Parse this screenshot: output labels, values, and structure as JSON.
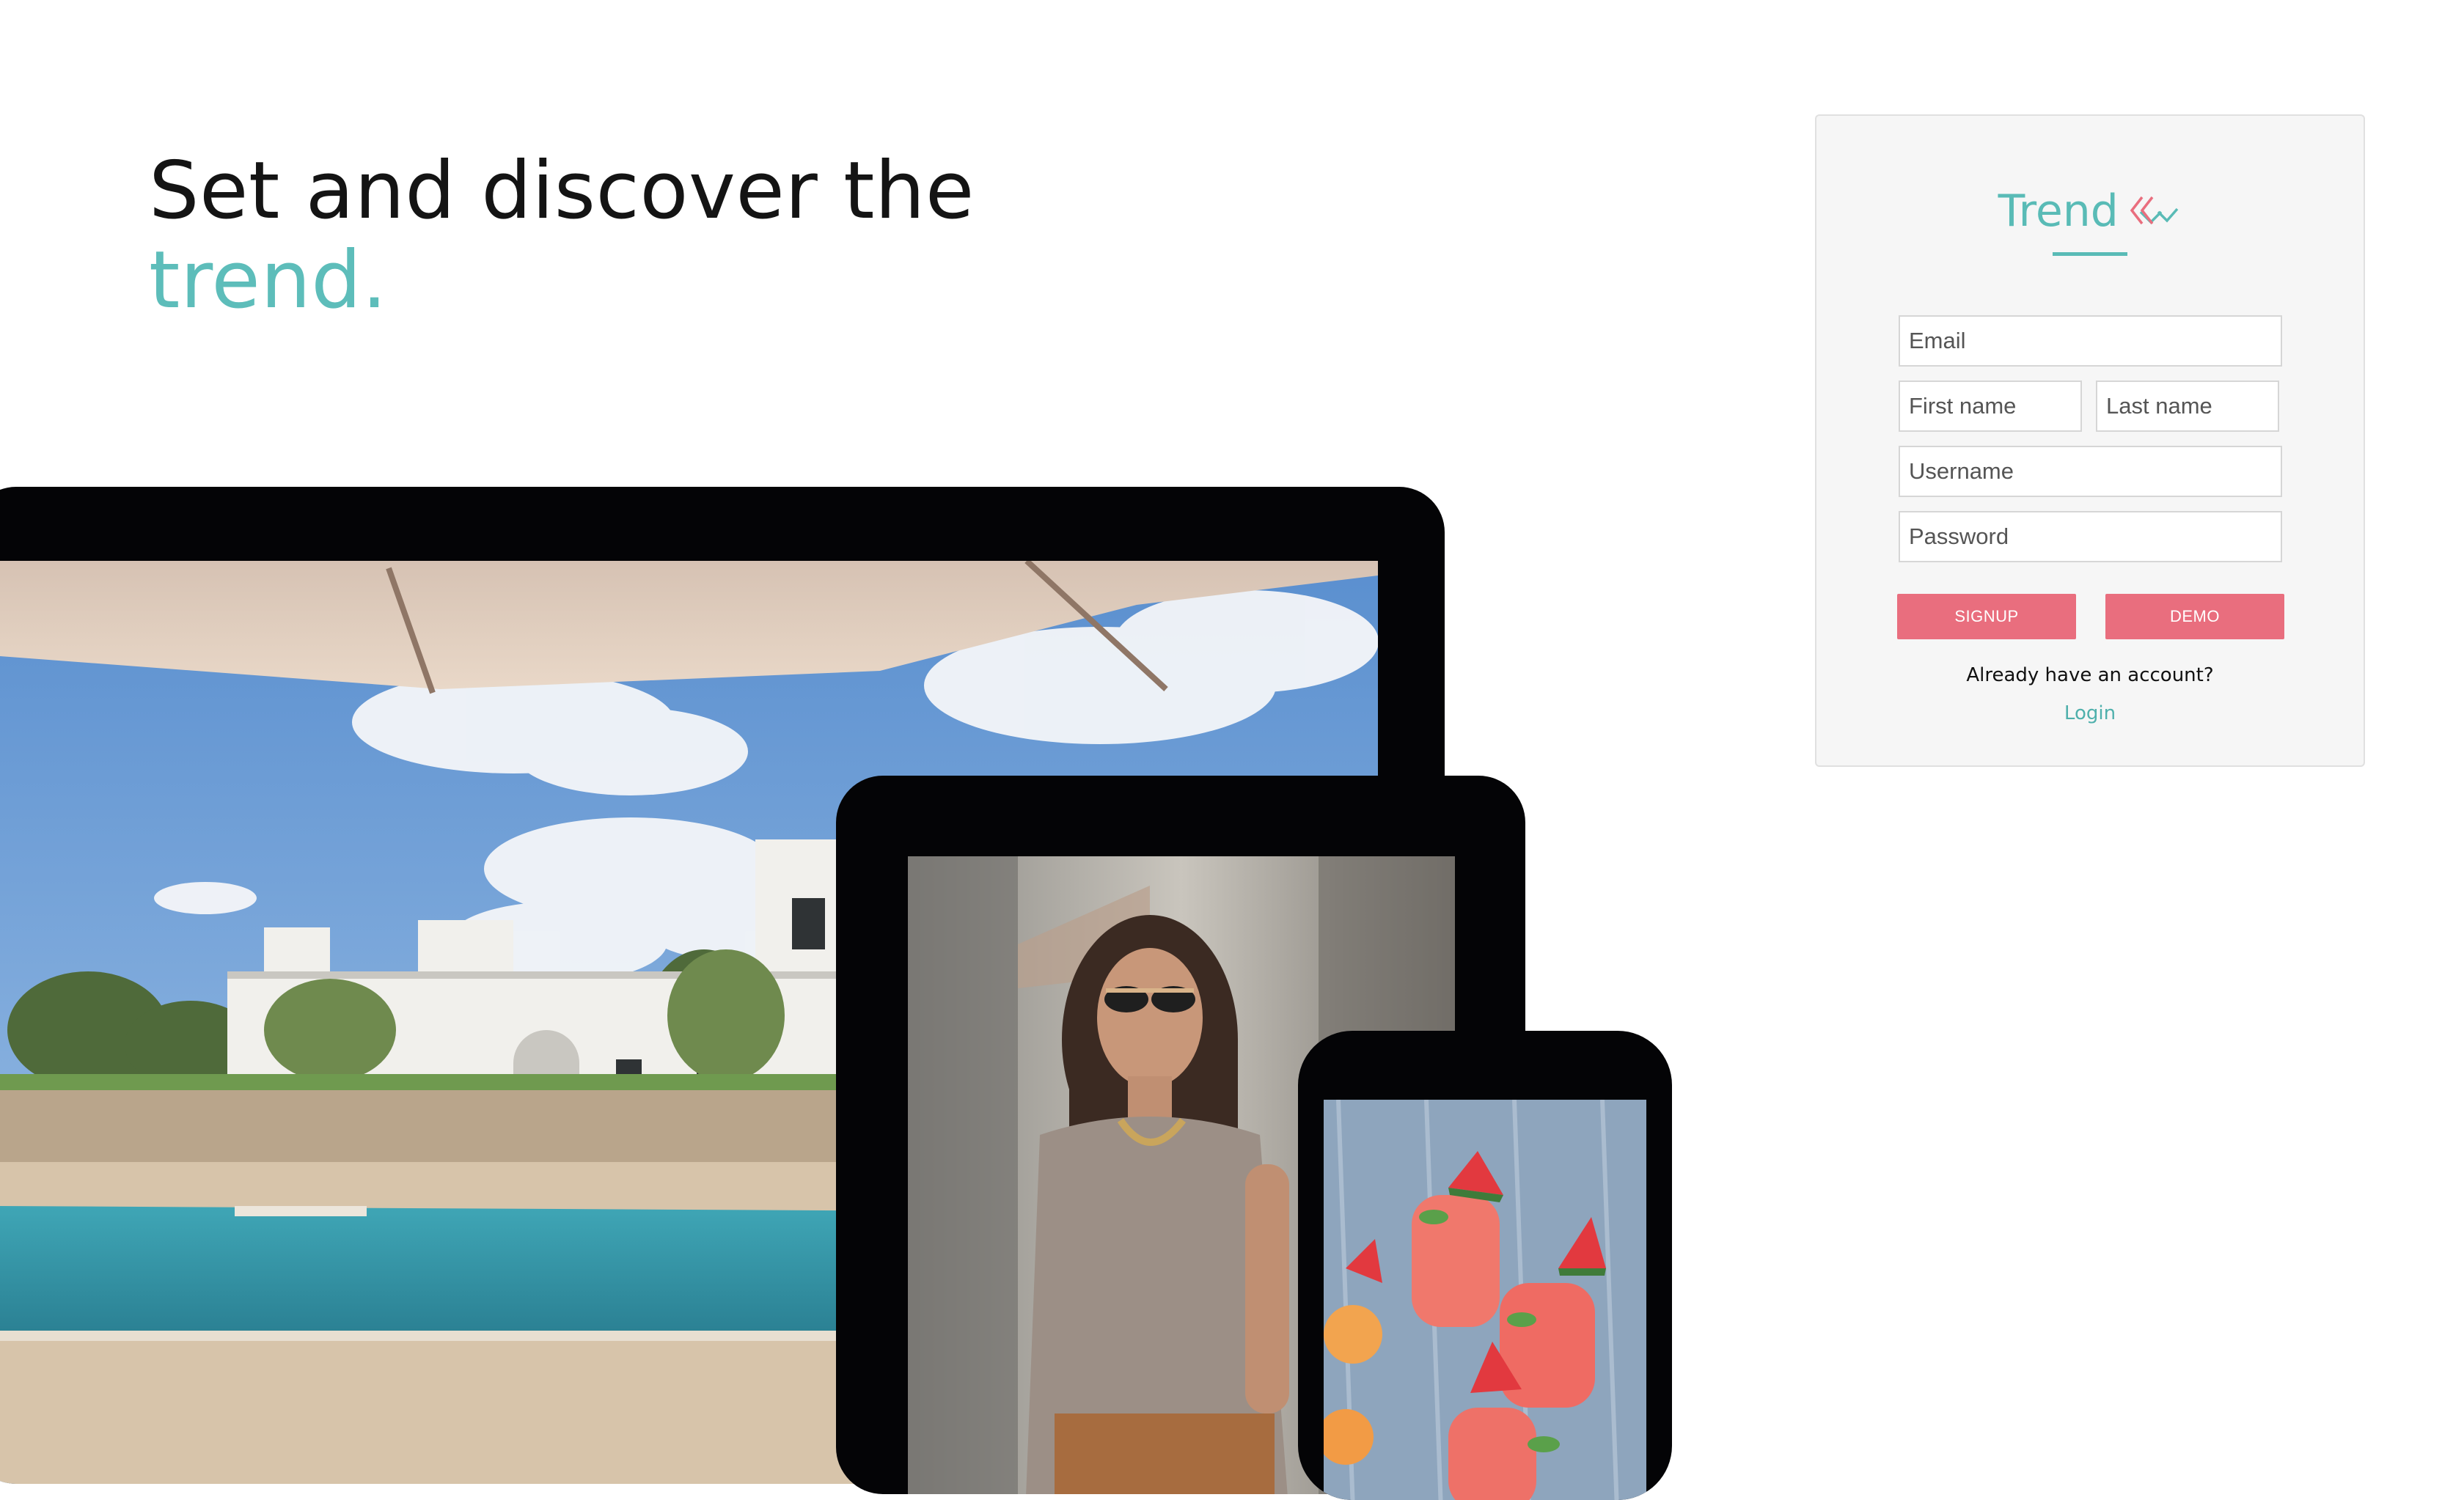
{
  "hero": {
    "line1": "Set and discover the",
    "line2": "trend."
  },
  "brand": {
    "name": "Trend",
    "accent_color": "#59bbb6",
    "icon": "trend-chevrons-logo"
  },
  "signup_form": {
    "email_placeholder": "Email",
    "first_name_placeholder": "First name",
    "last_name_placeholder": "Last name",
    "username_placeholder": "Username",
    "password_placeholder": "Password",
    "signup_label": "SIGNUP",
    "demo_label": "DEMO",
    "button_color": "#e96e7e",
    "already_text": "Already have an account?",
    "login_label": "Login"
  },
  "devices": {
    "laptop_image": "villa-with-pool",
    "tablet_image": "woman-with-sunglasses",
    "phone_image": "watermelon-drinks"
  }
}
